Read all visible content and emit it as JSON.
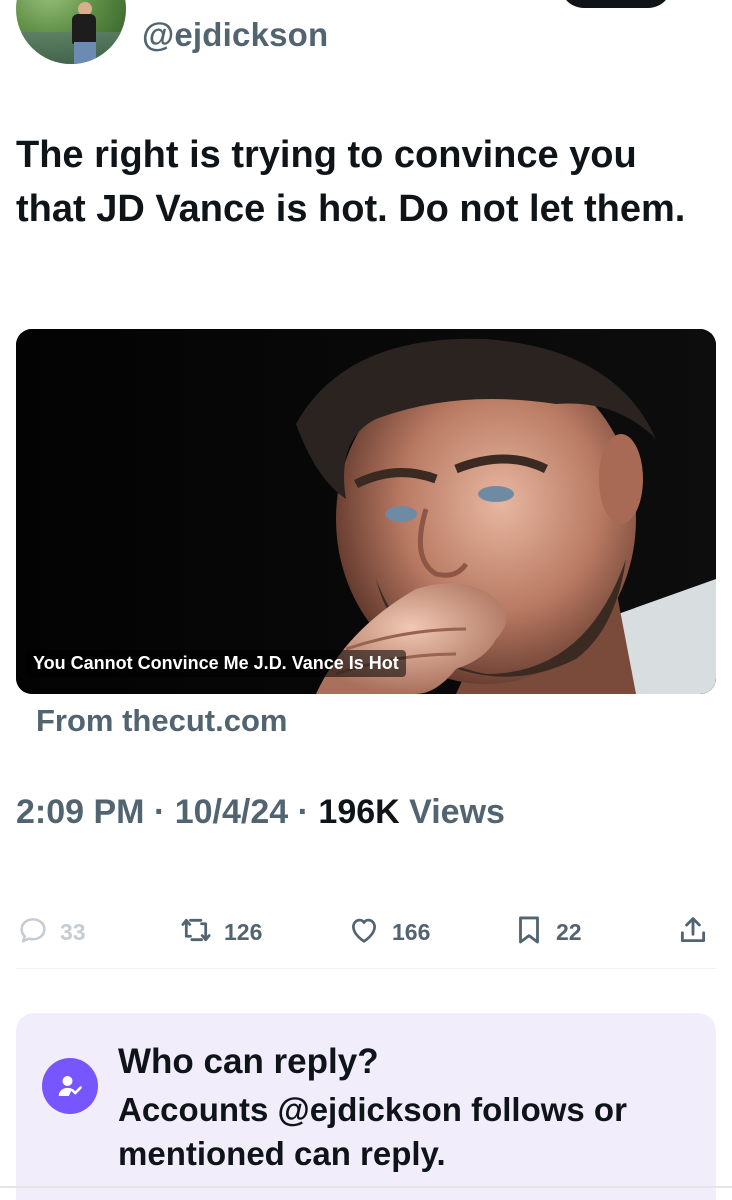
{
  "author": {
    "handle": "@ejdickson"
  },
  "tweet": {
    "text": "The right is trying to convince you that JD Vance is hot. Do not let them."
  },
  "media": {
    "caption": "You Cannot Convince Me J.D. Vance Is Hot",
    "source": "From thecut.com"
  },
  "meta": {
    "time": "2:09 PM",
    "date": "10/4/24",
    "views_count": "196K",
    "views_label": "Views"
  },
  "actions": {
    "replies": "33",
    "reposts": "126",
    "likes": "166",
    "bookmarks": "22"
  },
  "reply_settings": {
    "title": "Who can reply?",
    "description": "Accounts @ejdickson follows or mentioned can reply."
  },
  "colors": {
    "text_primary": "#0f1419",
    "text_secondary": "#536471",
    "reply_box_bg": "#f1edfb",
    "reply_icon_bg": "#7856ff"
  }
}
